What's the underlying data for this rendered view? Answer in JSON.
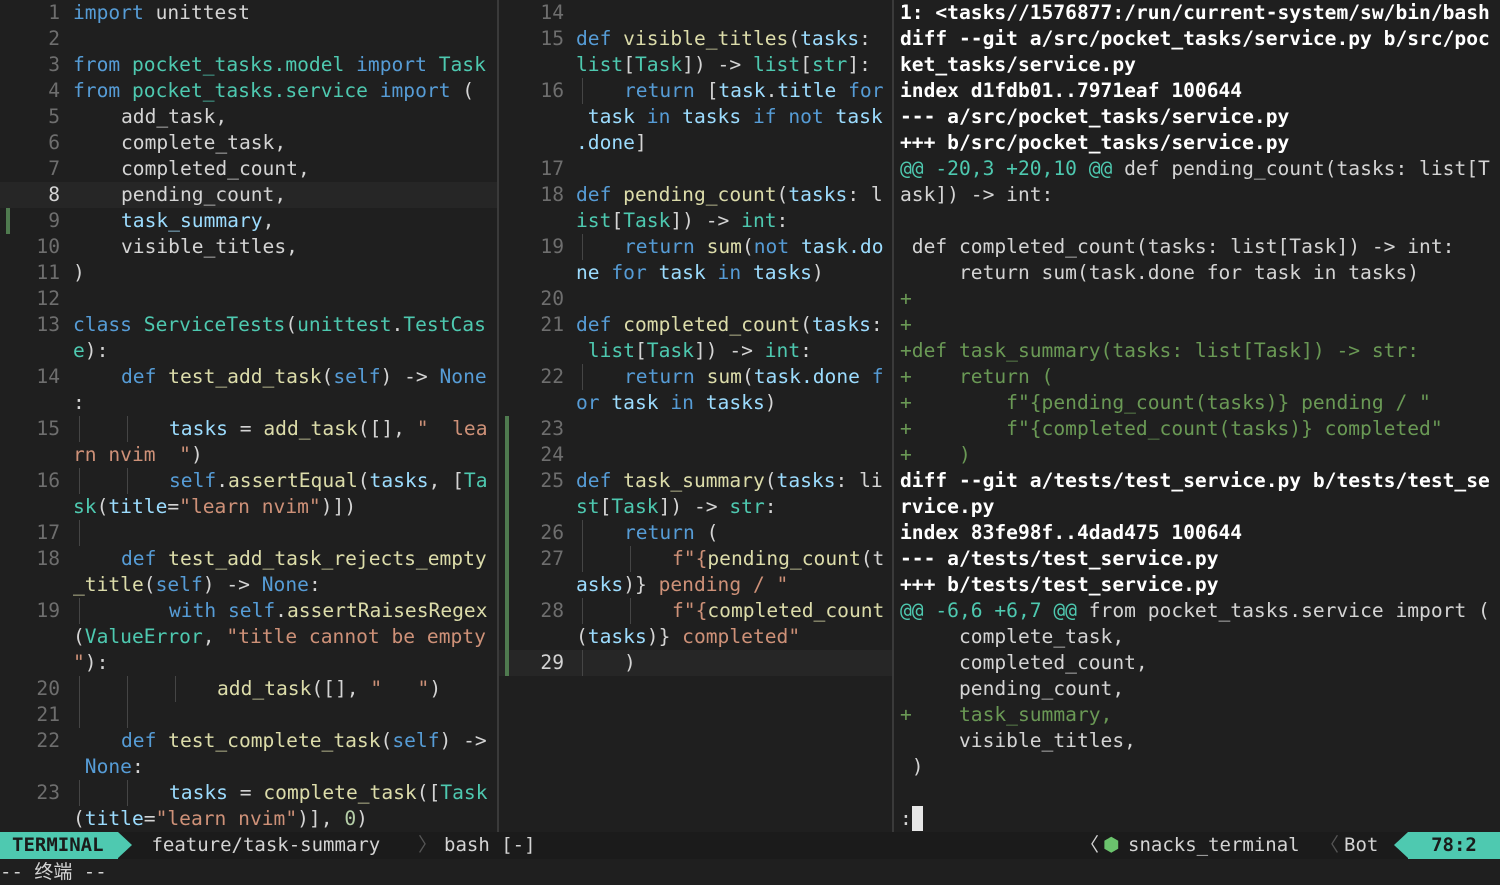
{
  "left_pane": {
    "lines": [
      {
        "n": "1",
        "segs": [
          [
            "import",
            "kw"
          ],
          [
            " unittest",
            "pl"
          ]
        ]
      },
      {
        "n": "2",
        "segs": []
      },
      {
        "n": "3",
        "segs": [
          [
            "from",
            "kw"
          ],
          [
            " pocket_tasks.model ",
            "ty"
          ],
          [
            "import",
            "kw"
          ],
          [
            " Task",
            "ty"
          ]
        ]
      },
      {
        "n": "4",
        "segs": [
          [
            "from",
            "kw"
          ],
          [
            " pocket_tasks.service ",
            "ty"
          ],
          [
            "import",
            "kw"
          ],
          [
            " (",
            "pl"
          ]
        ]
      },
      {
        "n": "5",
        "ind": 1,
        "segs": [
          [
            "add_task",
            "pl"
          ],
          [
            ",",
            "pl"
          ]
        ]
      },
      {
        "n": "6",
        "ind": 1,
        "segs": [
          [
            "complete_task",
            "pl"
          ],
          [
            ",",
            "pl"
          ]
        ]
      },
      {
        "n": "7",
        "ind": 1,
        "segs": [
          [
            "completed_count",
            "pl"
          ],
          [
            ",",
            "pl"
          ]
        ]
      },
      {
        "n": "8",
        "ind": 1,
        "cur": true,
        "segs": [
          [
            "pending_count",
            "pl"
          ],
          [
            ",",
            "pl"
          ]
        ]
      },
      {
        "n": "9",
        "ind": 1,
        "sign": "#4f7a4f",
        "segs": [
          [
            "task_summary",
            "va"
          ],
          [
            ",",
            "pl"
          ]
        ]
      },
      {
        "n": "10",
        "ind": 1,
        "segs": [
          [
            "visible_titles",
            "pl"
          ],
          [
            ",",
            "pl"
          ]
        ]
      },
      {
        "n": "11",
        "segs": [
          [
            ")",
            "pl"
          ]
        ]
      },
      {
        "n": "12",
        "segs": []
      },
      {
        "n": "13",
        "segs": [
          [
            "class",
            "kw"
          ],
          [
            " ServiceTests",
            "ty"
          ],
          [
            "(",
            "pl"
          ],
          [
            "unittest",
            "ty"
          ],
          [
            ".",
            "pl"
          ],
          [
            "TestCas",
            "ty"
          ]
        ]
      },
      {
        "n": "",
        "segs": [
          [
            "e",
            "ty"
          ],
          [
            "):",
            "pl"
          ]
        ]
      },
      {
        "n": "14",
        "ind": 1,
        "segs": [
          [
            "def",
            "kw"
          ],
          [
            " test_add_task",
            "fn"
          ],
          [
            "(",
            "pl"
          ],
          [
            "self",
            "kw"
          ],
          [
            ") -> ",
            "pl"
          ],
          [
            "None",
            "kw"
          ]
        ]
      },
      {
        "n": "",
        "segs": [
          [
            ":",
            "pl"
          ]
        ]
      },
      {
        "n": "15",
        "ind": 2,
        "g": 2,
        "segs": [
          [
            "tasks",
            "va"
          ],
          [
            " = ",
            "pl"
          ],
          [
            "add_task",
            "fn"
          ],
          [
            "([], ",
            "pl"
          ],
          [
            "\"  lea",
            "st"
          ]
        ]
      },
      {
        "n": "",
        "segs": [
          [
            "rn nvim  \"",
            "st"
          ],
          [
            ")",
            "pl"
          ]
        ]
      },
      {
        "n": "16",
        "ind": 2,
        "g": 2,
        "segs": [
          [
            "self",
            "kw"
          ],
          [
            ".",
            "pl"
          ],
          [
            "assertEqual",
            "fn"
          ],
          [
            "(",
            "pl"
          ],
          [
            "tasks",
            "va"
          ],
          [
            ", [",
            "pl"
          ],
          [
            "Ta",
            "ty"
          ]
        ]
      },
      {
        "n": "",
        "segs": [
          [
            "sk",
            "ty"
          ],
          [
            "(",
            "pl"
          ],
          [
            "title",
            "va"
          ],
          [
            "=",
            "pl"
          ],
          [
            "\"learn nvim\"",
            "st"
          ],
          [
            ")])",
            "pl"
          ]
        ]
      },
      {
        "n": "17",
        "g": 1,
        "segs": []
      },
      {
        "n": "18",
        "ind": 1,
        "segs": [
          [
            "def",
            "kw"
          ],
          [
            " test_add_task_rejects_empty",
            "fn"
          ]
        ]
      },
      {
        "n": "",
        "segs": [
          [
            "_title",
            "fn"
          ],
          [
            "(",
            "pl"
          ],
          [
            "self",
            "kw"
          ],
          [
            ") -> ",
            "pl"
          ],
          [
            "None",
            "kw"
          ],
          [
            ":",
            "pl"
          ]
        ]
      },
      {
        "n": "19",
        "ind": 2,
        "g": 1,
        "segs": [
          [
            "with",
            "kw"
          ],
          [
            " ",
            "pl"
          ],
          [
            "self",
            "kw"
          ],
          [
            ".",
            "pl"
          ],
          [
            "assertRaisesRegex",
            "fn"
          ]
        ]
      },
      {
        "n": "",
        "segs": [
          [
            "(",
            "pl"
          ],
          [
            "ValueError",
            "ty"
          ],
          [
            ", ",
            "pl"
          ],
          [
            "\"title cannot be empty",
            "st"
          ]
        ]
      },
      {
        "n": "",
        "segs": [
          [
            "\"",
            "st"
          ],
          [
            "):",
            "pl"
          ]
        ]
      },
      {
        "n": "20",
        "ind": 3,
        "g": 3,
        "segs": [
          [
            "add_task",
            "fn"
          ],
          [
            "([], ",
            "pl"
          ],
          [
            "\"   \"",
            "st"
          ],
          [
            ")",
            "pl"
          ]
        ]
      },
      {
        "n": "21",
        "g": 2,
        "segs": []
      },
      {
        "n": "22",
        "ind": 1,
        "segs": [
          [
            "def",
            "kw"
          ],
          [
            " test_complete_task",
            "fn"
          ],
          [
            "(",
            "pl"
          ],
          [
            "self",
            "kw"
          ],
          [
            ") ->",
            "pl"
          ]
        ]
      },
      {
        "n": "",
        "segs": [
          [
            " None",
            "kw"
          ],
          [
            ":",
            "pl"
          ]
        ]
      },
      {
        "n": "23",
        "ind": 2,
        "g": 2,
        "segs": [
          [
            "tasks",
            "va"
          ],
          [
            " = ",
            "pl"
          ],
          [
            "complete_task",
            "fn"
          ],
          [
            "([",
            "pl"
          ],
          [
            "Task",
            "ty"
          ]
        ]
      },
      {
        "n": "",
        "segs": [
          [
            "(",
            "pl"
          ],
          [
            "title",
            "va"
          ],
          [
            "=",
            "pl"
          ],
          [
            "\"learn nvim\"",
            "st"
          ],
          [
            ")], ",
            "pl"
          ],
          [
            "0",
            "nu"
          ],
          [
            ")",
            "pl"
          ]
        ]
      }
    ]
  },
  "middle_pane": {
    "lines": [
      {
        "n": "14",
        "segs": []
      },
      {
        "n": "15",
        "segs": [
          [
            "def",
            "kw"
          ],
          [
            " visible_titles",
            "fn"
          ],
          [
            "(",
            "pl"
          ],
          [
            "tasks",
            "va"
          ],
          [
            ":",
            "pl"
          ]
        ]
      },
      {
        "n": "",
        "segs": [
          [
            "list",
            "ty"
          ],
          [
            "[",
            "pl"
          ],
          [
            "Task",
            "ty"
          ],
          [
            "]) -> ",
            "pl"
          ],
          [
            "list",
            "ty"
          ],
          [
            "[",
            "pl"
          ],
          [
            "str",
            "ty"
          ],
          [
            "]:",
            "pl"
          ]
        ]
      },
      {
        "n": "16",
        "ind": 1,
        "g": 1,
        "segs": [
          [
            "return",
            "kw"
          ],
          [
            " [",
            "pl"
          ],
          [
            "task",
            "va"
          ],
          [
            ".",
            "pl"
          ],
          [
            "title",
            "va"
          ],
          [
            " for",
            "kw"
          ]
        ]
      },
      {
        "n": "",
        "segs": [
          [
            " task",
            "va"
          ],
          [
            " in",
            "kw"
          ],
          [
            " tasks",
            "va"
          ],
          [
            " if",
            "kw"
          ],
          [
            " not",
            "kw"
          ],
          [
            " task",
            "va"
          ]
        ]
      },
      {
        "n": "",
        "segs": [
          [
            ".done",
            "va"
          ],
          [
            "]",
            "pl"
          ]
        ]
      },
      {
        "n": "17",
        "segs": []
      },
      {
        "n": "18",
        "segs": [
          [
            "def",
            "kw"
          ],
          [
            " pending_count",
            "fn"
          ],
          [
            "(",
            "pl"
          ],
          [
            "tasks",
            "va"
          ],
          [
            ": l",
            "pl"
          ]
        ]
      },
      {
        "n": "",
        "segs": [
          [
            "ist",
            "ty"
          ],
          [
            "[",
            "pl"
          ],
          [
            "Task",
            "ty"
          ],
          [
            "]) -> ",
            "pl"
          ],
          [
            "int",
            "ty"
          ],
          [
            ":",
            "pl"
          ]
        ]
      },
      {
        "n": "19",
        "ind": 1,
        "g": 1,
        "segs": [
          [
            "return",
            "kw"
          ],
          [
            " sum",
            "fn"
          ],
          [
            "(",
            "pl"
          ],
          [
            "not",
            "kw"
          ],
          [
            " task",
            "va"
          ],
          [
            ".do",
            "va"
          ]
        ]
      },
      {
        "n": "",
        "segs": [
          [
            "ne",
            "va"
          ],
          [
            " for",
            "kw"
          ],
          [
            " task",
            "va"
          ],
          [
            " in",
            "kw"
          ],
          [
            " tasks",
            "va"
          ],
          [
            ")",
            "pl"
          ]
        ]
      },
      {
        "n": "20",
        "segs": []
      },
      {
        "n": "21",
        "segs": [
          [
            "def",
            "kw"
          ],
          [
            " completed_count",
            "fn"
          ],
          [
            "(",
            "pl"
          ],
          [
            "tasks",
            "va"
          ],
          [
            ":",
            "pl"
          ]
        ]
      },
      {
        "n": "",
        "segs": [
          [
            " list",
            "ty"
          ],
          [
            "[",
            "pl"
          ],
          [
            "Task",
            "ty"
          ],
          [
            "]) -> ",
            "pl"
          ],
          [
            "int",
            "ty"
          ],
          [
            ":",
            "pl"
          ]
        ]
      },
      {
        "n": "22",
        "ind": 1,
        "g": 1,
        "segs": [
          [
            "return",
            "kw"
          ],
          [
            " sum",
            "fn"
          ],
          [
            "(",
            "pl"
          ],
          [
            "task",
            "va"
          ],
          [
            ".done",
            "va"
          ],
          [
            " f",
            "kw"
          ]
        ]
      },
      {
        "n": "",
        "segs": [
          [
            "or",
            "kw"
          ],
          [
            " task",
            "va"
          ],
          [
            " in",
            "kw"
          ],
          [
            " tasks",
            "va"
          ],
          [
            ")",
            "pl"
          ]
        ]
      },
      {
        "n": "23",
        "sign": "#4f7a4f",
        "segs": []
      },
      {
        "n": "24",
        "sign": "#4f7a4f",
        "segs": []
      },
      {
        "n": "25",
        "sign": "#4f7a4f",
        "segs": [
          [
            "def",
            "kw"
          ],
          [
            " task_summary",
            "fn"
          ],
          [
            "(",
            "pl"
          ],
          [
            "tasks",
            "va"
          ],
          [
            ": li",
            "pl"
          ]
        ]
      },
      {
        "n": "",
        "sign": "#4f7a4f",
        "segs": [
          [
            "st",
            "ty"
          ],
          [
            "[",
            "pl"
          ],
          [
            "Task",
            "ty"
          ],
          [
            "]) -> ",
            "pl"
          ],
          [
            "str",
            "ty"
          ],
          [
            ":",
            "pl"
          ]
        ]
      },
      {
        "n": "26",
        "ind": 1,
        "g": 1,
        "sign": "#4f7a4f",
        "segs": [
          [
            "return",
            "kw"
          ],
          [
            " (",
            "pl"
          ]
        ]
      },
      {
        "n": "27",
        "ind": 2,
        "g": 2,
        "sign": "#4f7a4f",
        "segs": [
          [
            "f\"{",
            "st"
          ],
          [
            "pending_count",
            "fn"
          ],
          [
            "(t",
            "pl"
          ]
        ]
      },
      {
        "n": "",
        "sign": "#4f7a4f",
        "segs": [
          [
            "asks",
            "va"
          ],
          [
            ")}",
            "pl"
          ],
          [
            " pending / \"",
            "st"
          ]
        ]
      },
      {
        "n": "28",
        "ind": 2,
        "g": 2,
        "sign": "#4f7a4f",
        "segs": [
          [
            "f\"{",
            "st"
          ],
          [
            "completed_count",
            "fn"
          ]
        ]
      },
      {
        "n": "",
        "sign": "#4f7a4f",
        "segs": [
          [
            "(",
            "pl"
          ],
          [
            "tasks",
            "va"
          ],
          [
            ")}",
            "pl"
          ],
          [
            " completed\"",
            "st"
          ]
        ]
      },
      {
        "n": "29",
        "ind": 1,
        "g": 1,
        "cur": true,
        "sign": "#4f7a4f",
        "segs": [
          [
            ")",
            "pl"
          ]
        ]
      }
    ]
  },
  "right_pane": {
    "lines": [
      {
        "t": "1: <tasks//1576877:/run/current-system/sw/bin/bash",
        "c": "dh"
      },
      {
        "t": "diff --git a/src/pocket_tasks/service.py b/src/poc",
        "c": "dh"
      },
      {
        "t": "ket_tasks/service.py",
        "c": "dh"
      },
      {
        "t": "index d1fdb01..7971eaf 100644",
        "c": "dh"
      },
      {
        "t": "--- a/src/pocket_tasks/service.py",
        "c": "dh"
      },
      {
        "t": "+++ b/src/pocket_tasks/service.py",
        "c": "dh"
      },
      {
        "t": "@@ -20,3 +20,10 @@",
        "c": "hu",
        "rest": " def pending_count(tasks: list[T"
      },
      {
        "t": "ask]) -> int:",
        "c": "pl"
      },
      {
        "t": "",
        "c": "pl"
      },
      {
        "t": " def completed_count(tasks: list[Task]) -> int:",
        "c": "pl"
      },
      {
        "t": "     return sum(task.done for task in tasks)",
        "c": "pl"
      },
      {
        "t": "+",
        "c": "ad"
      },
      {
        "t": "+",
        "c": "ad"
      },
      {
        "t": "+def task_summary(tasks: list[Task]) -> str:",
        "c": "ad"
      },
      {
        "t": "+    return (",
        "c": "ad"
      },
      {
        "t": "+        f\"{pending_count(tasks)} pending / \"",
        "c": "ad"
      },
      {
        "t": "+        f\"{completed_count(tasks)} completed\"",
        "c": "ad"
      },
      {
        "t": "+    )",
        "c": "ad"
      },
      {
        "t": "diff --git a/tests/test_service.py b/tests/test_se",
        "c": "dh"
      },
      {
        "t": "rvice.py",
        "c": "dh"
      },
      {
        "t": "index 83fe98f..4dad475 100644",
        "c": "dh"
      },
      {
        "t": "--- a/tests/test_service.py",
        "c": "dh"
      },
      {
        "t": "+++ b/tests/test_service.py",
        "c": "dh"
      },
      {
        "t": "@@ -6,6 +6,7 @@",
        "c": "hu",
        "rest": " from pocket_tasks.service import ("
      },
      {
        "t": "     complete_task,",
        "c": "pl"
      },
      {
        "t": "     completed_count,",
        "c": "pl"
      },
      {
        "t": "     pending_count,",
        "c": "pl"
      },
      {
        "t": "+    task_summary,",
        "c": "ad"
      },
      {
        "t": "     visible_titles,",
        "c": "pl"
      },
      {
        "t": " )",
        "c": "pl"
      },
      {
        "t": "",
        "c": "pl"
      },
      {
        "t": ":",
        "c": "pl"
      }
    ]
  },
  "statusline": {
    "mode": "TERMINAL",
    "branch_icon": "",
    "branch": "feature/task-summary",
    "separator": "〉",
    "terminal": "bash [-]",
    "os_icon": "",
    "chevron": "〈",
    "filetype_icon": "⬢",
    "filetype": "snacks_terminal",
    "separator2": "〈",
    "scroll": "Bot",
    "position": "78:2"
  },
  "cmdline": "-- 终端 --"
}
